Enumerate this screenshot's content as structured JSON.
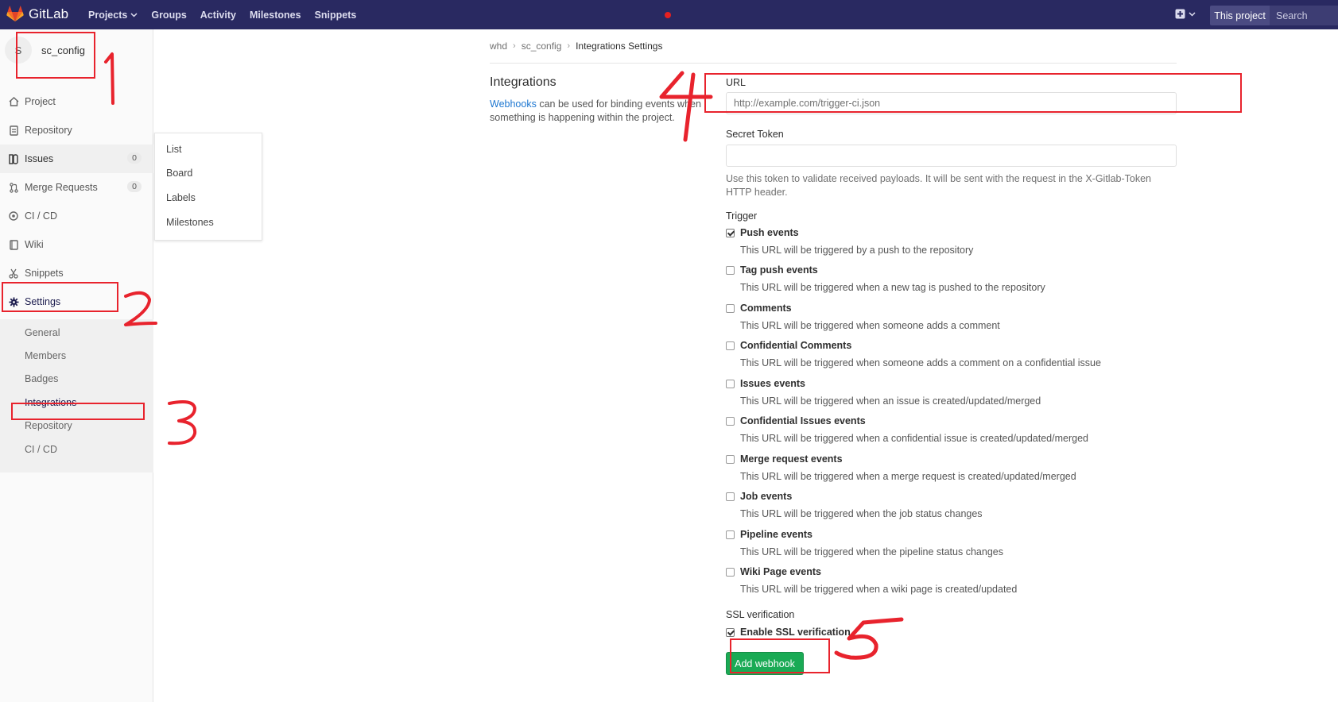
{
  "colors": {
    "nav_bg": "#292961",
    "accent": "#1aaa55",
    "link": "#1f78d1",
    "annotation": "#e8232d"
  },
  "nav": {
    "brand": "GitLab",
    "links": [
      "Projects",
      "Groups",
      "Activity",
      "Milestones",
      "Snippets"
    ],
    "scope_button": "This project",
    "search_placeholder": "Search"
  },
  "sidebar": {
    "avatar_letter": "S",
    "project_name": "sc_config",
    "items": [
      {
        "label": "Project",
        "icon": "home-icon"
      },
      {
        "label": "Repository",
        "icon": "doc-icon"
      },
      {
        "label": "Issues",
        "icon": "issues-icon",
        "count": "0"
      },
      {
        "label": "Merge Requests",
        "icon": "merge-icon",
        "count": "0"
      },
      {
        "label": "CI / CD",
        "icon": "rocket-icon"
      },
      {
        "label": "Wiki",
        "icon": "book-icon"
      },
      {
        "label": "Snippets",
        "icon": "scissors-icon"
      },
      {
        "label": "Settings",
        "icon": "gear-icon"
      }
    ],
    "settings_sub": [
      "General",
      "Members",
      "Badges",
      "Integrations",
      "Repository",
      "CI / CD"
    ]
  },
  "issues_flyout": [
    "List",
    "Board",
    "Labels",
    "Milestones"
  ],
  "breadcrumb": [
    "whd",
    "sc_config",
    "Integrations Settings"
  ],
  "integrations": {
    "title": "Integrations",
    "link_text": "Webhooks",
    "description": " can be used for binding events when something is happening within the project."
  },
  "form": {
    "url_label": "URL",
    "url_placeholder": "http://example.com/trigger-ci.json",
    "token_label": "Secret Token",
    "token_help": "Use this token to validate received payloads. It will be sent with the request in the X-Gitlab-Token HTTP header.",
    "trigger_label": "Trigger",
    "triggers": [
      {
        "name": "Push events",
        "desc": "This URL will be triggered by a push to the repository",
        "checked": true
      },
      {
        "name": "Tag push events",
        "desc": "This URL will be triggered when a new tag is pushed to the repository",
        "checked": false
      },
      {
        "name": "Comments",
        "desc": "This URL will be triggered when someone adds a comment",
        "checked": false
      },
      {
        "name": "Confidential Comments",
        "desc": "This URL will be triggered when someone adds a comment on a confidential issue",
        "checked": false
      },
      {
        "name": "Issues events",
        "desc": "This URL will be triggered when an issue is created/updated/merged",
        "checked": false
      },
      {
        "name": "Confidential Issues events",
        "desc": "This URL will be triggered when a confidential issue is created/updated/merged",
        "checked": false
      },
      {
        "name": "Merge request events",
        "desc": "This URL will be triggered when a merge request is created/updated/merged",
        "checked": false
      },
      {
        "name": "Job events",
        "desc": "This URL will be triggered when the job status changes",
        "checked": false
      },
      {
        "name": "Pipeline events",
        "desc": "This URL will be triggered when the pipeline status changes",
        "checked": false
      },
      {
        "name": "Wiki Page events",
        "desc": "This URL will be triggered when a wiki page is created/updated",
        "checked": false
      }
    ],
    "ssl_label": "SSL verification",
    "ssl_option": "Enable SSL verification",
    "ssl_checked": true,
    "submit_label": "Add webhook"
  },
  "annotations": [
    "1",
    "2",
    "3",
    "4",
    "5"
  ]
}
